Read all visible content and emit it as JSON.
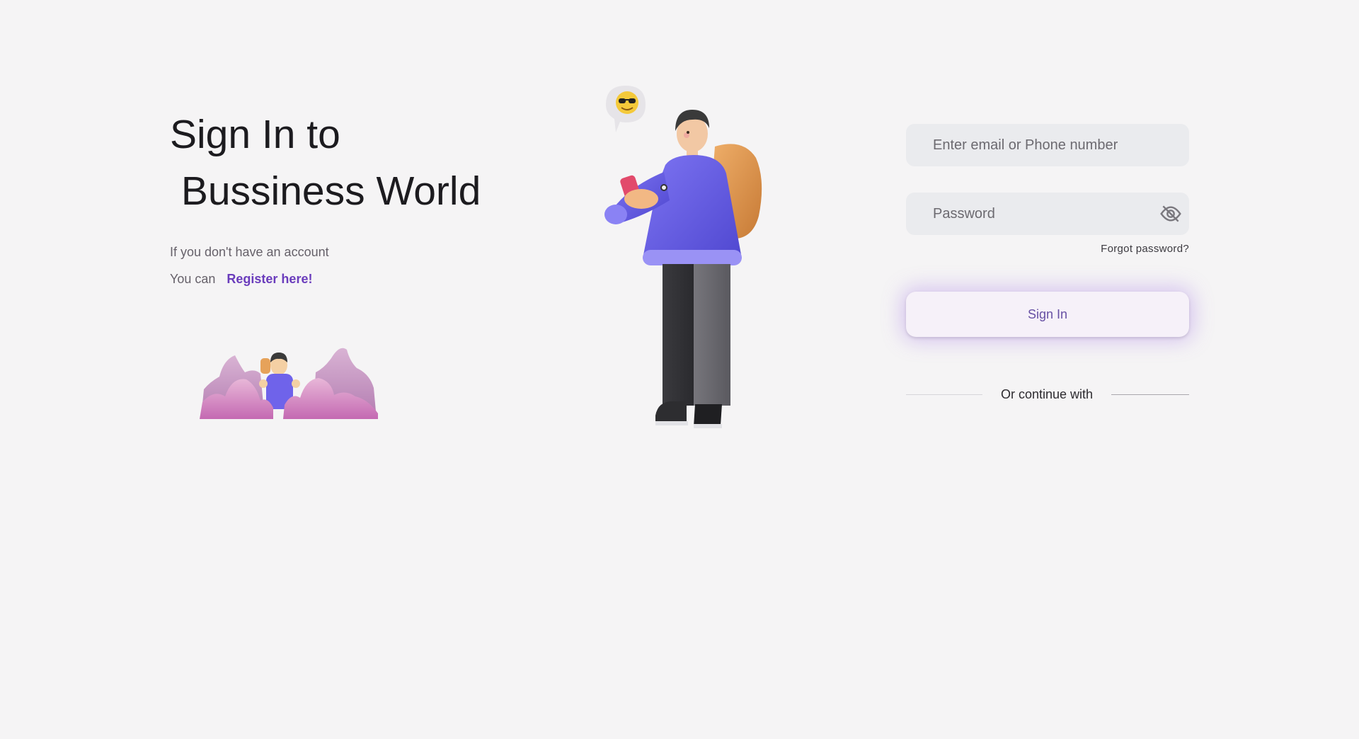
{
  "heading": {
    "line1": "Sign In to",
    "line2": " Bussiness World"
  },
  "subtext": {
    "no_account": "If you don't have an account",
    "you_can": "You can",
    "register_link": "Register here!"
  },
  "form": {
    "email_placeholder": "Enter email or Phone number",
    "password_placeholder": "Password",
    "forgot_password": "Forgot password?",
    "sign_in_button": "Sign In",
    "divider_text": "Or continue with"
  },
  "icons": {
    "password_toggle": "eye-off-icon",
    "chat_bubble": "emoji-sunglasses-icon"
  },
  "colors": {
    "background": "#f5f4f5",
    "accent": "#6a3cbc",
    "button_text": "#6750a4",
    "field_bg": "#eaebee"
  }
}
